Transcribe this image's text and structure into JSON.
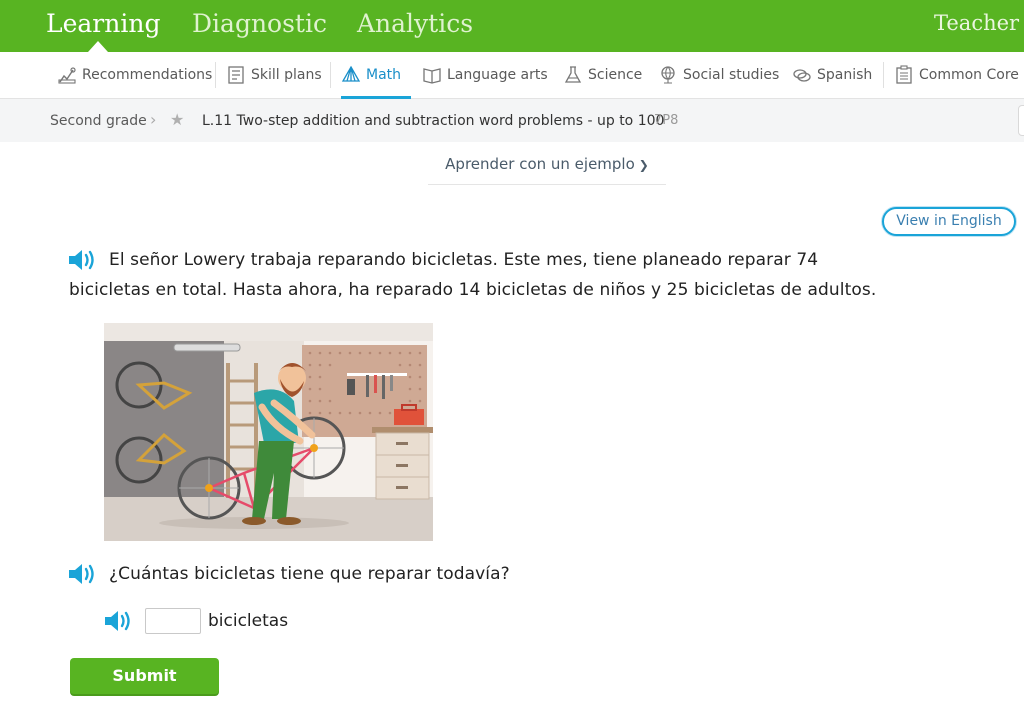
{
  "topnav": {
    "tabs": [
      {
        "label": "Learning",
        "active": true
      },
      {
        "label": "Diagnostic",
        "active": false
      },
      {
        "label": "Analytics",
        "active": false
      }
    ],
    "teacher_label": "Teacher re"
  },
  "subjects": [
    {
      "label": "Recommendations",
      "icon": "recommendations-icon"
    },
    {
      "label": "Skill plans",
      "icon": "skill-plans-icon"
    },
    {
      "label": "Math",
      "icon": "math-icon",
      "active": true
    },
    {
      "label": "Language arts",
      "icon": "language-arts-icon"
    },
    {
      "label": "Science",
      "icon": "science-icon"
    },
    {
      "label": "Social studies",
      "icon": "social-studies-icon"
    },
    {
      "label": "Spanish",
      "icon": "spanish-icon"
    },
    {
      "label": "Common Core",
      "icon": "common-core-icon"
    }
  ],
  "breadcrumb": {
    "grade": "Second grade",
    "skill": "L.11 Two-step addition and subtraction word problems - up to 100",
    "code": "7P8"
  },
  "learn_example": "Aprender con un ejemplo",
  "view_in_english": "View in English",
  "question": {
    "line1": "El señor Lowery trabaja reparando bicicletas. Este mes, tiene planeado reparar 74",
    "line2": "bicicletas en total. Hasta ahora, ha reparado 14 bicicletas de niños y 25 bicicletas de adultos.",
    "prompt": "¿Cuántas bicicletas tiene que reparar todavía?",
    "answer_value": "",
    "unit": "bicicletas"
  },
  "submit_label": "Submit",
  "colors": {
    "brand_green": "#58b422",
    "accent_blue": "#1aa4d8"
  }
}
